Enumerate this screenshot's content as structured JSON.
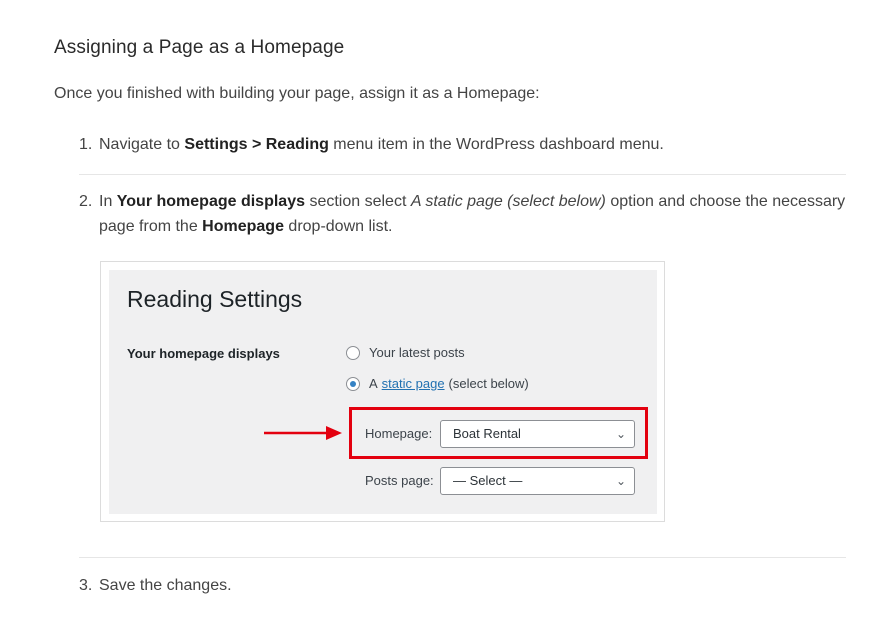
{
  "heading": "Assigning a Page as a Homepage",
  "intro": "Once you finished with building your page, assign it as a Homepage:",
  "steps": [
    {
      "num": "1.",
      "prefix": "Navigate to ",
      "bold": "Settings > Reading",
      "suffix": " menu item in the WordPress dashboard menu."
    },
    {
      "num": "2.",
      "prefix": "In ",
      "bold1": "Your homepage displays",
      "mid1": " section select ",
      "italic": "A static page (select below)",
      "mid2": " option and choose the necessary",
      "line2_prefix": "page from the ",
      "bold2": "Homepage",
      "line2_suffix": " drop-down list."
    },
    {
      "num": "3.",
      "text": "Save the changes."
    }
  ],
  "screenshot": {
    "title": "Reading Settings",
    "section_label": "Your homepage displays",
    "option_latest": "Your latest posts",
    "option_static_prefix": "A",
    "option_static_link": "static page",
    "option_static_suffix": "(select below)",
    "homepage_label": "Homepage:",
    "homepage_value": "Boat Rental",
    "posts_label": "Posts page:",
    "posts_value": "— Select —",
    "highlight_color": "#e3000f",
    "accent_color": "#2271b1"
  }
}
